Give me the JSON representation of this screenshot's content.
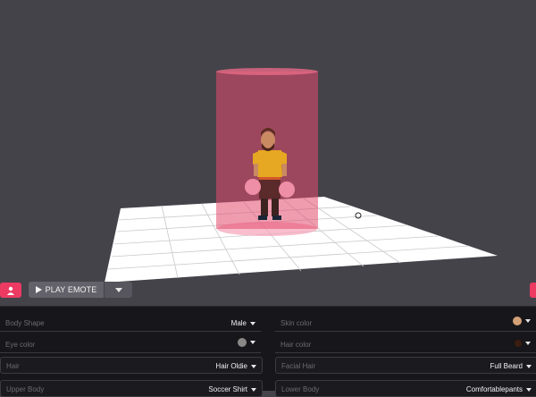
{
  "toolbar": {
    "play_label": "PLAY EMOTE",
    "avatar_icon": "user-icon",
    "play_icon": "play-icon",
    "caret_icon": "chevron-down-icon"
  },
  "colors": {
    "background": "#45434a",
    "accent": "#ec3a63",
    "panel": "#17161a",
    "skin": "#d3a176",
    "eye": "#8a8886",
    "hair": "#3b1e10"
  },
  "attributes": {
    "body_shape": {
      "label": "Body Shape",
      "value": "Male"
    },
    "skin_color": {
      "label": "Skin color"
    },
    "eye_color": {
      "label": "Eye color"
    },
    "hair_color": {
      "label": "Hair color"
    },
    "hair": {
      "label": "Hair",
      "value": "Hair Oldie"
    },
    "facial_hair": {
      "label": "Facial Hair",
      "value": "Full Beard"
    },
    "upper_body": {
      "label": "Upper Body",
      "value": "Soccer Shirt"
    },
    "lower_body": {
      "label": "Lower Body",
      "value": "Comfortablepants"
    }
  }
}
